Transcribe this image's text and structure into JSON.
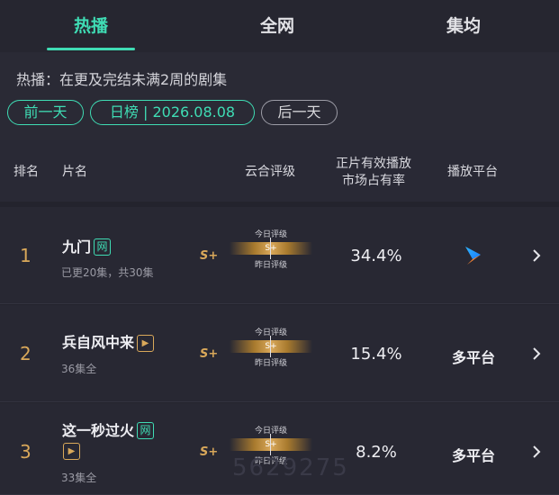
{
  "tabs": [
    {
      "label": "热播",
      "active": true
    },
    {
      "label": "全网",
      "active": false
    },
    {
      "label": "集均",
      "active": false
    }
  ],
  "description": "热播：在更及完结未满2周的剧集",
  "date_nav": {
    "prev_label": "前一天",
    "date_label": "日榜 | 2026.08.08",
    "next_label": "后一天"
  },
  "table_header": {
    "rank": "排名",
    "name": "片名",
    "rating": "云合评级",
    "share_line1": "正片有效播放",
    "share_line2": "市场占有率",
    "platform": "播放平台"
  },
  "rating_labels": {
    "today": "今日评级",
    "yesterday": "昨日评级"
  },
  "rows": [
    {
      "rank": "1",
      "name": "九门",
      "badge": "网",
      "episodes": "已更20集，共30集",
      "grade": "S+",
      "grade_bar": "S+",
      "share": "34.4%",
      "platform": "",
      "platform_icon": "youku-icon"
    },
    {
      "rank": "2",
      "name": "兵自风中来",
      "badge": "▶",
      "episodes": "36集全",
      "grade": "S+",
      "grade_bar": "S+",
      "share": "15.4%",
      "platform": "多平台"
    },
    {
      "rank": "3",
      "name": "这一秒过火",
      "badge": "网",
      "badge2": "▶",
      "episodes": "33集全",
      "grade": "S+",
      "grade_bar": "S+",
      "share": "8.2%",
      "platform": "多平台"
    }
  ],
  "watermark_number": "5629275",
  "colors": {
    "accent": "#3fdcb4",
    "gold": "#d9a85a",
    "background": "#23232d"
  }
}
